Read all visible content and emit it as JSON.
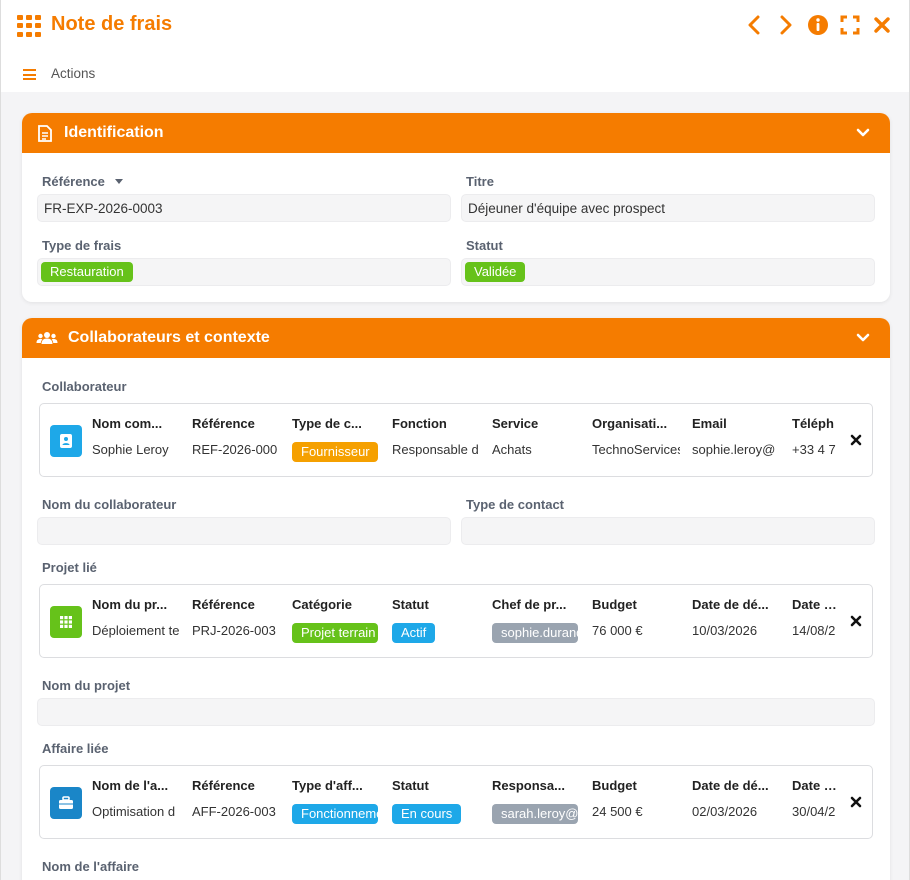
{
  "window": {
    "title": "Note de frais"
  },
  "toolbar": {
    "actions_label": "Actions"
  },
  "identification": {
    "title": "Identification",
    "reference_label": "Référence",
    "reference_value": "FR-EXP-2026-0003",
    "titre_label": "Titre",
    "titre_value": "Déjeuner d'équipe avec prospect",
    "type_label": "Type de frais",
    "type_value": "Restauration",
    "statut_label": "Statut",
    "statut_value": "Validée"
  },
  "context": {
    "title": "Collaborateurs et contexte",
    "collab_section": "Collaborateur",
    "collab_headers": [
      "Nom com...",
      "Référence",
      "Type de c...",
      "Fonction",
      "Service",
      "Organisati...",
      "Email",
      "Téléph"
    ],
    "collab_values": [
      "Sophie Leroy",
      "REF-2026-000",
      "Fournisseur",
      "Responsable d",
      "Achats",
      "TechnoServices",
      "sophie.leroy@",
      "+33 4 7"
    ],
    "nom_collab_label": "Nom du collaborateur",
    "type_contact_label": "Type de contact",
    "projet_section": "Projet lié",
    "projet_headers": [
      "Nom du pr...",
      "Référence",
      "Catégorie",
      "Statut",
      "Chef de pr...",
      "Budget",
      "Date de dé...",
      "Date de"
    ],
    "projet_values": [
      "Déploiement te",
      "PRJ-2026-003",
      "Projet terrain",
      "Actif",
      "sophie.durand",
      "76 000 €",
      "10/03/2026",
      "14/08/2"
    ],
    "nom_projet_label": "Nom du projet",
    "affaire_section": "Affaire liée",
    "affaire_headers": [
      "Nom de l'a...",
      "Référence",
      "Type d'aff...",
      "Statut",
      "Responsa...",
      "Budget",
      "Date de dé...",
      "Date de"
    ],
    "affaire_values": [
      "Optimisation d",
      "AFF-2026-003",
      "Fonctionnement",
      "En cours",
      "sarah.leroy@",
      "24 500 €",
      "02/03/2026",
      "30/04/2"
    ],
    "nom_affaire_label": "Nom de l'affaire"
  },
  "colors": {
    "accent": "#f57c00",
    "green": "#66c21a",
    "blue": "#1ea8e8",
    "orange_badge": "#f5a000",
    "grey_badge": "#9aa4b0"
  }
}
